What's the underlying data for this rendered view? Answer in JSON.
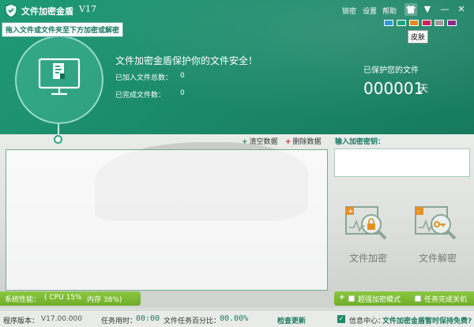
{
  "title": {
    "app_name": "文件加密金盾",
    "version": "V17"
  },
  "menu": {
    "lock": "锁密",
    "settings": "设置",
    "help": "帮助"
  },
  "skin": {
    "tooltip": "皮肤",
    "swatches": [
      "#2d9bd6",
      "#23a37c",
      "#e88a1a",
      "#d0205a",
      "#9b9b9b",
      "#8b2a8c"
    ]
  },
  "drop_hint": "拖入文件或文件夹至下方加密或解密",
  "banner": {
    "slogan": "文件加密金盾保护你的文件安全！",
    "added_files_label": "已加入文件总数：",
    "added_files_value": "0",
    "done_files_label": "已完成文件数：",
    "done_files_value": "0",
    "protect_label": "已保护您的文件",
    "protect_days": "000001",
    "protect_unit": "天"
  },
  "toolbar": {
    "clear": "清空数据",
    "delete": "删除数据"
  },
  "key": {
    "label": "输入加密密钥：",
    "value": ""
  },
  "actions": {
    "encrypt": "文件加密",
    "decrypt": "文件解密"
  },
  "system": {
    "perf_label": "系统性能：",
    "cpu": "( CPU 15%",
    "mem": "内存 38%)",
    "super_mode": "超强加密模式",
    "shutdown": "任务完成关机"
  },
  "status": {
    "version_label": "程序版本：",
    "version_value": "V17.00.000",
    "time_label": "任务用时：",
    "time_value": "00:00",
    "percent_label": "文件任务百分比：",
    "percent_value": "00.00%",
    "update": "检查更新",
    "info_label": "信息中心：",
    "info_value": "文件加密金盾暂时保持免费?"
  },
  "colors": {
    "primary": "#1b8a6a",
    "accent": "#7ab83a",
    "text_green": "#1b7a62"
  }
}
